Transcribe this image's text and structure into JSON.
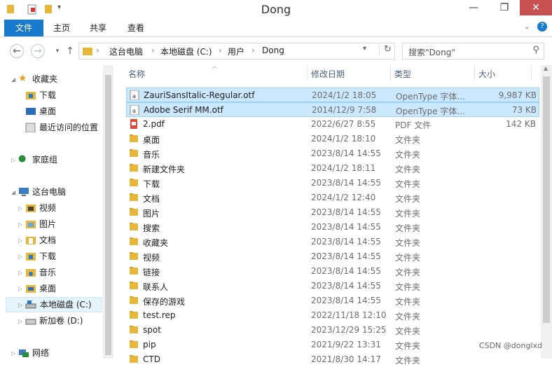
{
  "window": {
    "title": "Dong"
  },
  "ribbon": {
    "tabs": [
      "文件",
      "主页",
      "共享",
      "查看"
    ]
  },
  "address": {
    "breadcrumbs": [
      "这台电脑",
      "本地磁盘 (C:)",
      "用户",
      "Dong"
    ],
    "search_placeholder": "搜索\"Dong\""
  },
  "nav": [
    {
      "label": "收藏夹",
      "icon": "star-icon"
    },
    {
      "label": "下载",
      "icon": "download-folder-icon"
    },
    {
      "label": "桌面",
      "icon": "desktop-icon"
    },
    {
      "label": "最近访问的位置",
      "icon": "recent-places-icon"
    },
    {
      "label": "家庭组",
      "icon": "homegroup-icon"
    },
    {
      "label": "这台电脑",
      "icon": "computer-icon"
    },
    {
      "label": "视频",
      "icon": "videos-folder-icon"
    },
    {
      "label": "图片",
      "icon": "pictures-folder-icon"
    },
    {
      "label": "文档",
      "icon": "documents-folder-icon"
    },
    {
      "label": "下载",
      "icon": "download-folder-icon"
    },
    {
      "label": "音乐",
      "icon": "music-folder-icon"
    },
    {
      "label": "桌面",
      "icon": "desktop-folder-icon"
    },
    {
      "label": "本地磁盘 (C:)",
      "icon": "local-disk-icon"
    },
    {
      "label": "新加卷 (D:)",
      "icon": "drive-icon"
    },
    {
      "label": "网络",
      "icon": "network-icon"
    }
  ],
  "columns": {
    "name": "名称",
    "date": "修改日期",
    "type": "类型",
    "size": "大小"
  },
  "files": [
    {
      "name": "ZauriSansItalic-Regular.otf",
      "date": "2024/1/2 18:05",
      "type": "OpenType 字体...",
      "size": "9,987 KB",
      "icon": "font-file-icon",
      "selected": true
    },
    {
      "name": "Adobe Serif MM.otf",
      "date": "2014/12/9 7:58",
      "type": "OpenType 字体...",
      "size": "73 KB",
      "icon": "font-file-icon",
      "selected": true
    },
    {
      "name": "2.pdf",
      "date": "2022/6/27 8:55",
      "type": "PDF 文件",
      "size": "142 KB",
      "icon": "pdf-file-icon"
    },
    {
      "name": "桌面",
      "date": "2024/1/2 18:10",
      "type": "文件夹",
      "size": "",
      "icon": "folder-icon"
    },
    {
      "name": "音乐",
      "date": "2023/8/14 14:55",
      "type": "文件夹",
      "size": "",
      "icon": "folder-icon"
    },
    {
      "name": "新建文件夹",
      "date": "2024/1/2 18:11",
      "type": "文件夹",
      "size": "",
      "icon": "folder-icon"
    },
    {
      "name": "下载",
      "date": "2023/8/14 14:55",
      "type": "文件夹",
      "size": "",
      "icon": "folder-icon"
    },
    {
      "name": "文档",
      "date": "2024/1/2 12:40",
      "type": "文件夹",
      "size": "",
      "icon": "folder-icon"
    },
    {
      "name": "图片",
      "date": "2023/8/14 14:55",
      "type": "文件夹",
      "size": "",
      "icon": "folder-icon"
    },
    {
      "name": "搜索",
      "date": "2023/8/14 14:55",
      "type": "文件夹",
      "size": "",
      "icon": "folder-icon"
    },
    {
      "name": "收藏夹",
      "date": "2023/8/14 14:55",
      "type": "文件夹",
      "size": "",
      "icon": "folder-icon"
    },
    {
      "name": "视频",
      "date": "2023/8/14 14:55",
      "type": "文件夹",
      "size": "",
      "icon": "folder-icon"
    },
    {
      "name": "链接",
      "date": "2023/8/14 14:55",
      "type": "文件夹",
      "size": "",
      "icon": "folder-icon"
    },
    {
      "name": "联系人",
      "date": "2023/8/14 14:55",
      "type": "文件夹",
      "size": "",
      "icon": "folder-icon"
    },
    {
      "name": "保存的游戏",
      "date": "2023/8/14 14:55",
      "type": "文件夹",
      "size": "",
      "icon": "folder-icon"
    },
    {
      "name": "test.rep",
      "date": "2022/11/18 12:10",
      "type": "文件夹",
      "size": "",
      "icon": "folder-icon"
    },
    {
      "name": "spot",
      "date": "2023/12/29 15:25",
      "type": "文件夹",
      "size": "",
      "icon": "folder-icon"
    },
    {
      "name": "pip",
      "date": "2021/9/22 13:31",
      "type": "文件夹",
      "size": "",
      "icon": "folder-icon"
    },
    {
      "name": "CTD",
      "date": "2021/8/30 14:17",
      "type": "文件夹",
      "size": "",
      "icon": "folder-icon"
    }
  ],
  "watermark": "CSDN @donglxd",
  "colors": {
    "accent": "#1979ca",
    "selection": "#cce8ff",
    "close": "#c75050"
  }
}
